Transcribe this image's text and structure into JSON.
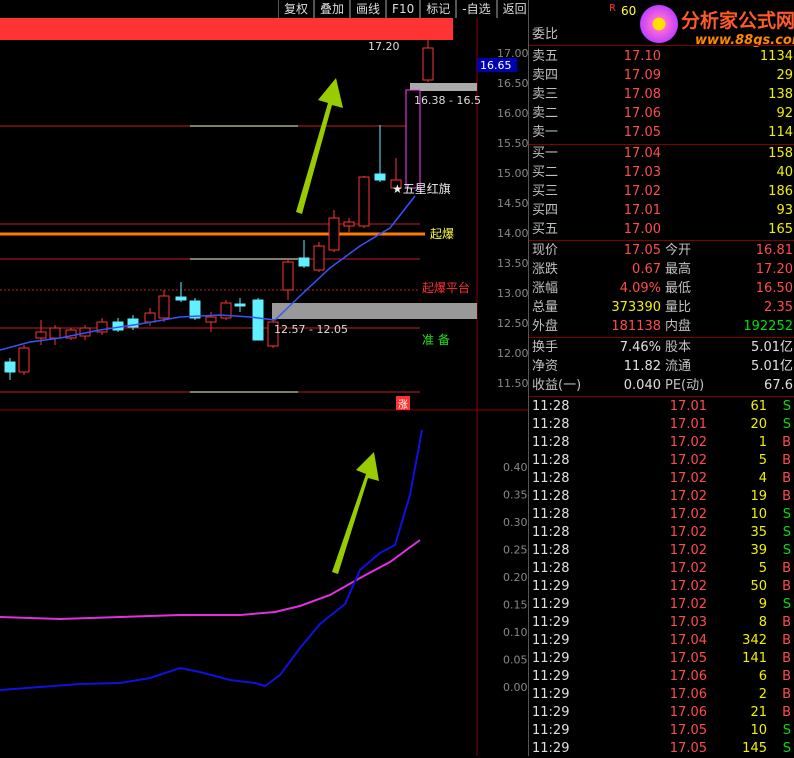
{
  "toolbar": {
    "buttons": [
      "复权",
      "叠加",
      "画线",
      "F10",
      "标记",
      "-自选",
      "返回"
    ]
  },
  "stock_code_partial": "60",
  "logo": {
    "title": "分析家公式网",
    "url": "www.88gs.com",
    "small": "R"
  },
  "chart": {
    "price_labels": [
      "17.00",
      "16.50",
      "16.00",
      "15.50",
      "15.00",
      "14.50",
      "14.00",
      "13.50",
      "13.00",
      "12.50",
      "12.00",
      "11.50"
    ],
    "current_price_tag": "16.65",
    "high_label": "17.20",
    "band1_label": "16.38 - 16.5",
    "band2_label": "12.57 - 12.05",
    "star_label": "五星红旗",
    "signal_qibao": "起爆",
    "signal_pingtai": "起爆平台",
    "signal_zhunbei": "准 备",
    "zhang_mark": "涨",
    "ind_labels": [
      "0.40",
      "0.35",
      "0.30",
      "0.25",
      "0.20",
      "0.15",
      "0.10",
      "0.05",
      "0.00"
    ]
  },
  "panel": {
    "weibi_label": "委比",
    "asks": [
      {
        "label": "卖五",
        "price": "17.10",
        "vol": "1134"
      },
      {
        "label": "卖四",
        "price": "17.09",
        "vol": "29"
      },
      {
        "label": "卖三",
        "price": "17.08",
        "vol": "138"
      },
      {
        "label": "卖二",
        "price": "17.06",
        "vol": "92"
      },
      {
        "label": "卖一",
        "price": "17.05",
        "vol": "114"
      }
    ],
    "bids": [
      {
        "label": "买一",
        "price": "17.04",
        "vol": "158"
      },
      {
        "label": "买二",
        "price": "17.03",
        "vol": "40"
      },
      {
        "label": "买三",
        "price": "17.02",
        "vol": "186"
      },
      {
        "label": "买四",
        "price": "17.01",
        "vol": "93"
      },
      {
        "label": "买五",
        "price": "17.00",
        "vol": "165"
      }
    ],
    "stats": [
      {
        "l1": "现价",
        "v1": "17.05",
        "c1": "red",
        "l2": "今开",
        "v2": "16.81",
        "c2": "red"
      },
      {
        "l1": "涨跌",
        "v1": "0.67",
        "c1": "red",
        "l2": "最高",
        "v2": "17.20",
        "c2": "red"
      },
      {
        "l1": "涨幅",
        "v1": "4.09%",
        "c1": "red",
        "l2": "最低",
        "v2": "16.50",
        "c2": "red"
      },
      {
        "l1": "总量",
        "v1": "373390",
        "c1": "yellow",
        "l2": "量比",
        "v2": "2.35",
        "c2": "red"
      },
      {
        "l1": "外盘",
        "v1": "181138",
        "c1": "red",
        "l2": "内盘",
        "v2": "192252",
        "c2": "green"
      }
    ],
    "stats2": [
      {
        "l1": "换手",
        "v1": "7.46%",
        "l2": "股本",
        "v2": "5.01亿"
      },
      {
        "l1": "净资",
        "v1": "11.82",
        "l2": "流通",
        "v2": "5.01亿"
      },
      {
        "l1": "收益(一)",
        "v1": "0.040",
        "l2": "PE(动)",
        "v2": "67.6"
      }
    ],
    "ticks": [
      {
        "t": "11:28",
        "p": "17.01",
        "v": "61",
        "s": "S"
      },
      {
        "t": "11:28",
        "p": "17.01",
        "v": "20",
        "s": "S"
      },
      {
        "t": "11:28",
        "p": "17.02",
        "v": "1",
        "s": "B"
      },
      {
        "t": "11:28",
        "p": "17.02",
        "v": "5",
        "s": "B"
      },
      {
        "t": "11:28",
        "p": "17.02",
        "v": "4",
        "s": "B"
      },
      {
        "t": "11:28",
        "p": "17.02",
        "v": "19",
        "s": "B"
      },
      {
        "t": "11:28",
        "p": "17.02",
        "v": "10",
        "s": "S"
      },
      {
        "t": "11:28",
        "p": "17.02",
        "v": "35",
        "s": "S"
      },
      {
        "t": "11:28",
        "p": "17.02",
        "v": "39",
        "s": "S"
      },
      {
        "t": "11:28",
        "p": "17.02",
        "v": "5",
        "s": "B"
      },
      {
        "t": "11:29",
        "p": "17.02",
        "v": "50",
        "s": "B"
      },
      {
        "t": "11:29",
        "p": "17.02",
        "v": "9",
        "s": "S"
      },
      {
        "t": "11:29",
        "p": "17.03",
        "v": "8",
        "s": "B"
      },
      {
        "t": "11:29",
        "p": "17.04",
        "v": "342",
        "s": "B"
      },
      {
        "t": "11:29",
        "p": "17.05",
        "v": "141",
        "s": "B"
      },
      {
        "t": "11:29",
        "p": "17.06",
        "v": "6",
        "s": "B"
      },
      {
        "t": "11:29",
        "p": "17.06",
        "v": "2",
        "s": "B"
      },
      {
        "t": "11:29",
        "p": "17.06",
        "v": "21",
        "s": "B"
      },
      {
        "t": "11:29",
        "p": "17.05",
        "v": "10",
        "s": "S"
      },
      {
        "t": "11:29",
        "p": "17.05",
        "v": "145",
        "s": "S"
      }
    ]
  }
}
